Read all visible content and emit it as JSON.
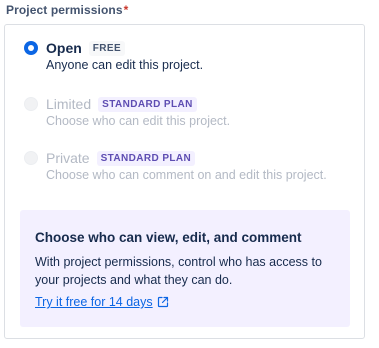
{
  "field": {
    "label": "Project permissions",
    "required_mark": "*"
  },
  "options": [
    {
      "title": "Open",
      "badge": "FREE",
      "description": "Anyone can edit this project.",
      "selected": true,
      "disabled": false
    },
    {
      "title": "Limited",
      "badge": "STANDARD PLAN",
      "description": "Choose who can edit this project.",
      "selected": false,
      "disabled": true
    },
    {
      "title": "Private",
      "badge": "STANDARD PLAN",
      "description": "Choose who can comment on and edit this project.",
      "selected": false,
      "disabled": true
    }
  ],
  "promo": {
    "title": "Choose who can view, edit, and comment",
    "body": "With project permissions, control who has access to your projects and what they can do.",
    "link_label": "Try it free for 14 days",
    "link_icon": "external-link-icon"
  },
  "colors": {
    "accent": "#0c66e4",
    "required": "#c9372c",
    "promo_background": "#f3f0ff",
    "plan_badge_text": "#5e4db2",
    "disabled_text": "#b3b9c4"
  }
}
